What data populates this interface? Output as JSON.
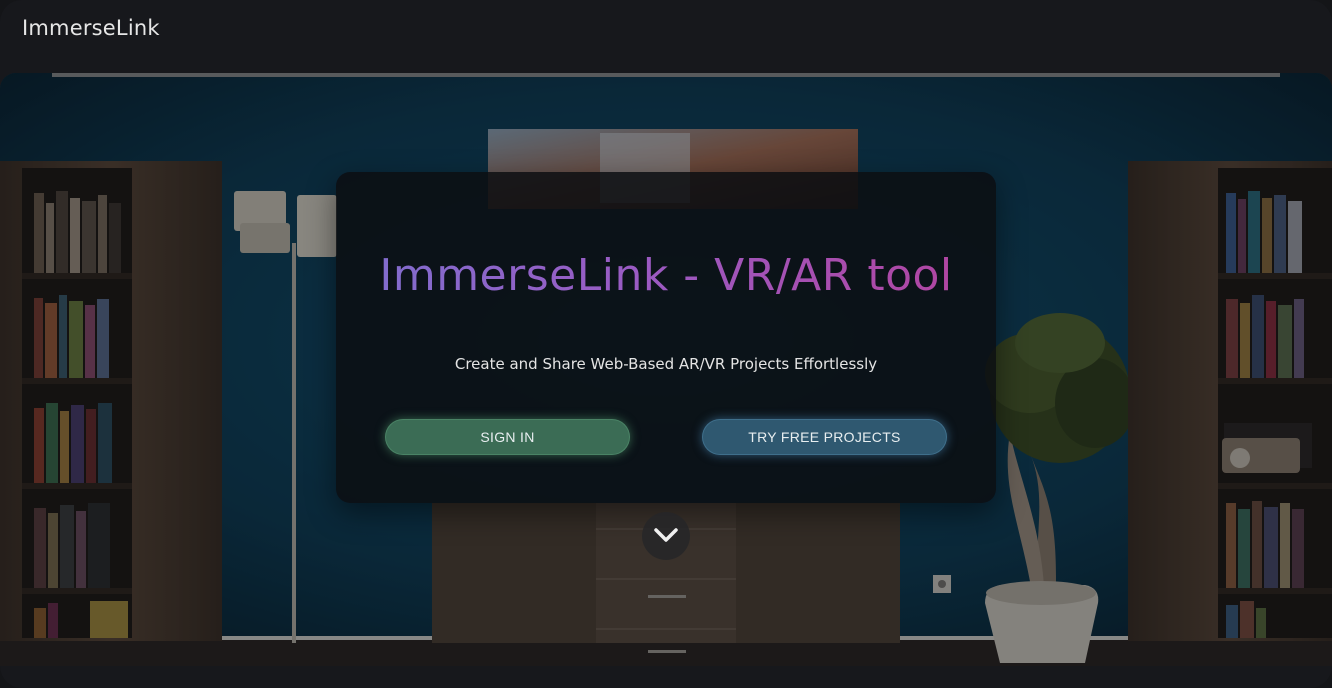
{
  "app": {
    "brand_name": "ImmerseLink"
  },
  "hero": {
    "background_image": "living-room-scene",
    "title": "ImmerseLink - VR/AR tool",
    "subtitle": "Create and Share Web-Based AR/VR Projects Effortlessly",
    "buttons": {
      "sign_in_label": "SIGN IN",
      "try_free_label": "TRY FREE PROJECTS"
    },
    "scroll_icon": "chevron-down-icon"
  },
  "colors": {
    "page_background": "#17181c",
    "title_gradient_start": "#7e6fcf",
    "title_gradient_end": "#b3439e",
    "sign_in_button": "#3b6c55",
    "try_free_button": "#2f5870",
    "wall": "#0d3a52"
  }
}
